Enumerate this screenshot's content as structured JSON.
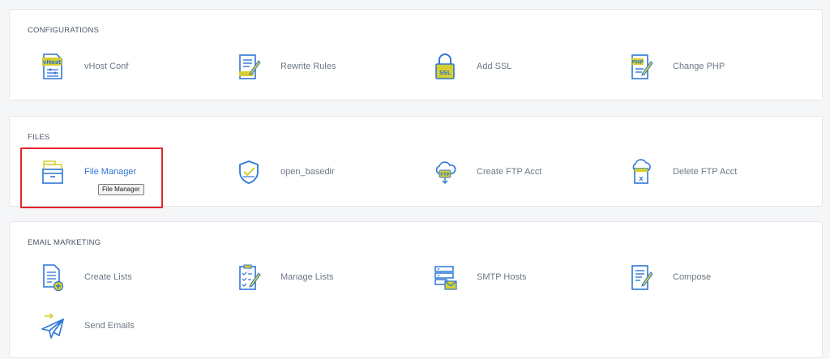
{
  "colors": {
    "icon_blue": "#2f77d6",
    "icon_yellow": "#d7cf2d",
    "highlight_red": "#e3262b",
    "active_link": "#2f77d6"
  },
  "sections": [
    {
      "title": "CONFIGURATIONS",
      "items": [
        {
          "label": "vHost Conf",
          "icon": "vhost-config-icon"
        },
        {
          "label": "Rewrite Rules",
          "icon": "rewrite-document-icon"
        },
        {
          "label": "Add SSL",
          "icon": "ssl-lock-icon"
        },
        {
          "label": "Change PHP",
          "icon": "php-document-icon"
        }
      ]
    },
    {
      "title": "FILES",
      "items": [
        {
          "label": "File Manager",
          "icon": "file-cabinet-icon"
        },
        {
          "label": "open_basedir",
          "icon": "shield-check-icon"
        },
        {
          "label": "Create FTP Acct",
          "icon": "cloud-ftp-icon"
        },
        {
          "label": "Delete FTP Acct",
          "icon": "cloud-folder-delete-icon"
        }
      ]
    },
    {
      "title": "EMAIL MARKETING",
      "items": [
        {
          "label": "Create Lists",
          "icon": "document-add-icon"
        },
        {
          "label": "Manage Lists",
          "icon": "checklist-edit-icon"
        },
        {
          "label": "SMTP Hosts",
          "icon": "server-mail-icon"
        },
        {
          "label": "Compose",
          "icon": "compose-document-icon"
        },
        {
          "label": "Send Emails",
          "icon": "paper-plane-icon"
        }
      ]
    }
  ],
  "tooltip": {
    "text": "File Manager"
  }
}
